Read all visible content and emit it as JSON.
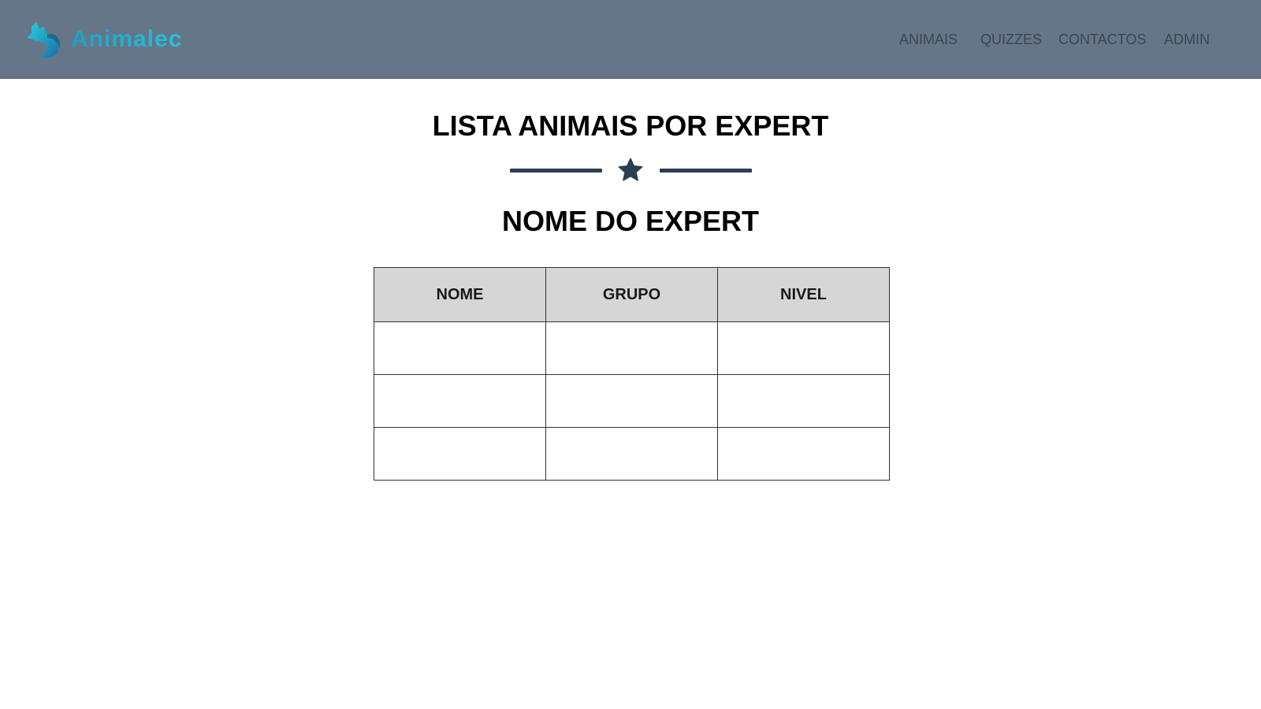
{
  "navbar": {
    "brand": {
      "name": "Animalec",
      "logo_icon": "fox-logo-icon",
      "color": "#1aa6c6"
    },
    "links": [
      {
        "label": "ANIMAIS"
      },
      {
        "label": "QUIZZES"
      },
      {
        "label": "CONTACTOS"
      },
      {
        "label": "ADMIN"
      }
    ],
    "background_color": "#657688"
  },
  "page": {
    "title": "LISTA ANIMAIS POR EXPERT",
    "divider_icon": "star-icon",
    "subtitle": "NOME DO EXPERT"
  },
  "table": {
    "headers": [
      "NOME",
      "GRUPO",
      "NIVEL"
    ],
    "rows": [
      [
        "",
        "",
        ""
      ],
      [
        "",
        "",
        ""
      ],
      [
        "",
        "",
        ""
      ]
    ]
  },
  "colors": {
    "accent": "#2c3e50",
    "table_header_bg": "#d6d6d6"
  }
}
